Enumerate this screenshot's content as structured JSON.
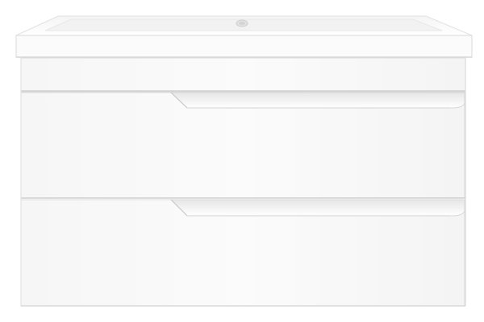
{
  "scene": {
    "subject": "wall-mounted-vanity-with-integrated-basin",
    "drawers": [
      {
        "name": "upper-drawer",
        "handle": "diagonal-cut-groove"
      },
      {
        "name": "lower-drawer",
        "handle": "diagonal-cut-groove"
      }
    ],
    "colors": {
      "background": "#ffffff",
      "cabinet_white": "#f8f8f8",
      "edge_shadow": "#dcdcdc",
      "outline": "#d0d0d0",
      "basin_inner": "#eeeeee"
    }
  }
}
